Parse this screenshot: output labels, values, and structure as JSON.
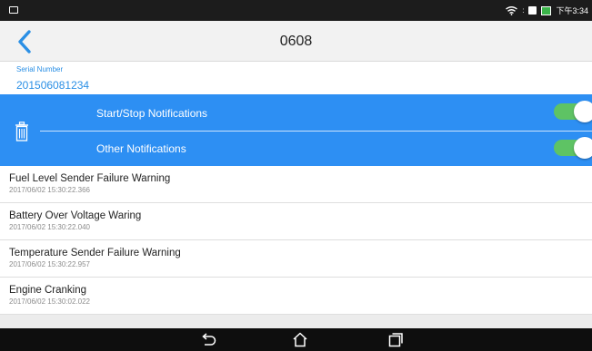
{
  "status_bar": {
    "time": "下午3:34"
  },
  "header": {
    "title": "0608",
    "back_icon": "chevron-left-icon"
  },
  "serial": {
    "label": "Serial Number",
    "value": "201506081234"
  },
  "settings": {
    "start_stop_label": "Start/Stop Notifications",
    "start_stop_on": true,
    "other_label": "Other Notifications",
    "other_on": true,
    "accent_color": "#2d8ff3",
    "toggle_color": "#5ec364"
  },
  "notifications": [
    {
      "title": "Fuel Level Sender Failure Warning",
      "time": "2017/06/02 15:30:22.366"
    },
    {
      "title": "Battery Over Voltage Waring",
      "time": "2017/06/02 15:30:22.040"
    },
    {
      "title": "Temperature Sender Failure Warning",
      "time": "2017/06/02 15:30:22.957"
    },
    {
      "title": "Engine Cranking",
      "time": "2017/06/02 15:30:02.022"
    }
  ]
}
